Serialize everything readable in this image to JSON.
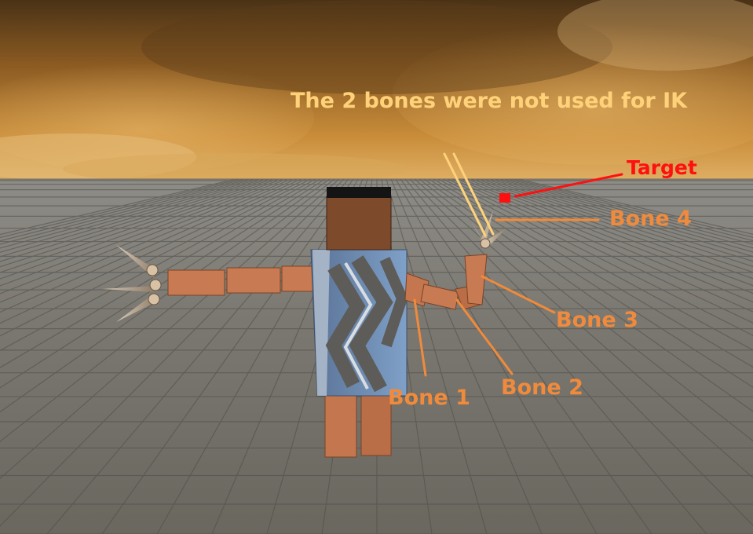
{
  "annotations": {
    "note": "The 2 bones were not used for IK",
    "target": "Target",
    "bone4": "Bone 4",
    "bone3": "Bone 3",
    "bone2": "Bone 2",
    "bone1": "Bone 1"
  },
  "colors": {
    "note": "#ffd27a",
    "target": "#ff1010",
    "bone_label": "#f08a3c",
    "skin": "#c87a52",
    "hair": "#141414",
    "torso": "#6f8fb5",
    "sky": "#b0782c",
    "ground": "#7c7a73"
  }
}
